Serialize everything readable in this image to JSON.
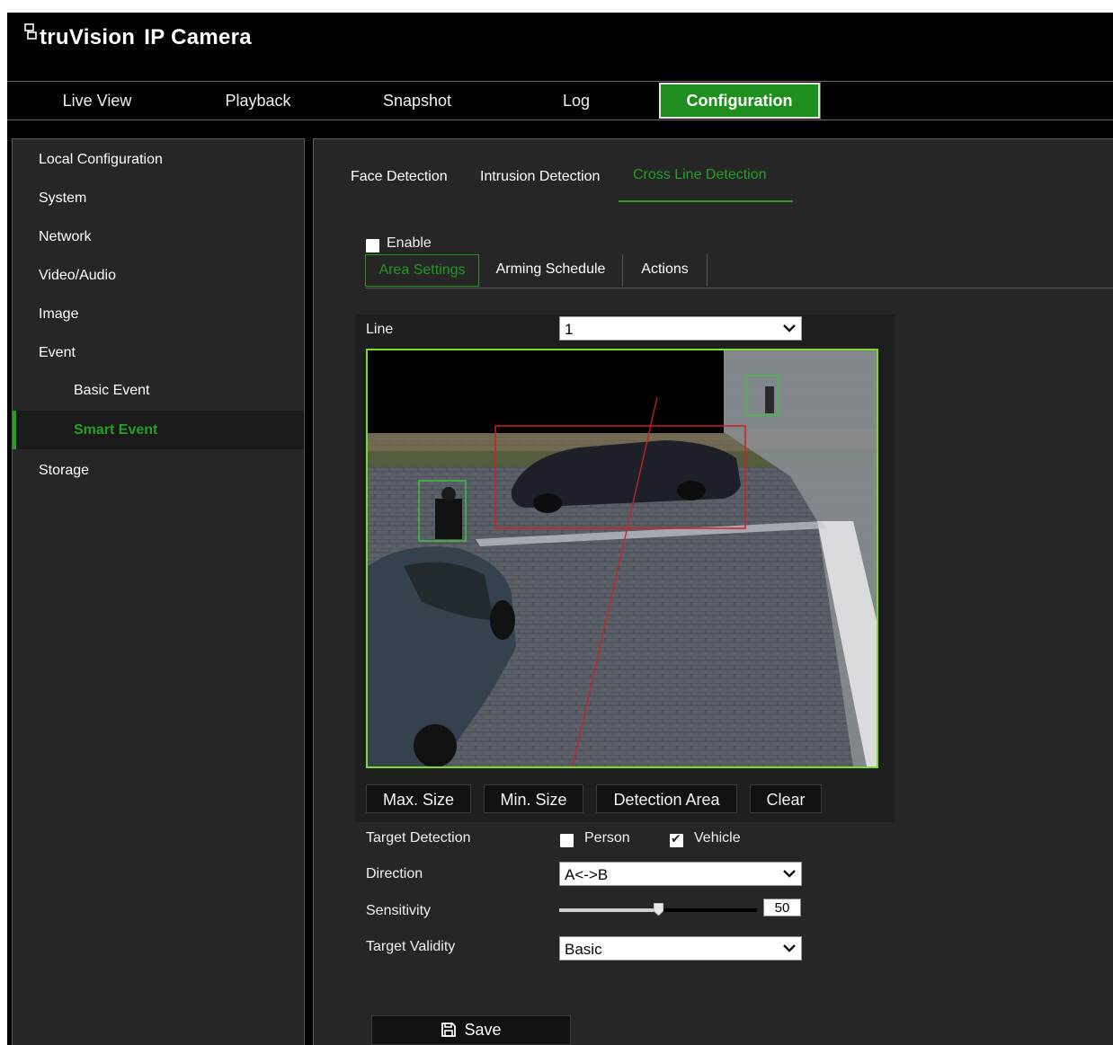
{
  "app": {
    "brand_prefix": "truVision",
    "brand_suffix": "IP Camera"
  },
  "nav": {
    "items": [
      "Live View",
      "Playback",
      "Snapshot",
      "Log",
      "Configuration"
    ],
    "active": "Configuration"
  },
  "sidebar": {
    "items": [
      "Local Configuration",
      "System",
      "Network",
      "Video/Audio",
      "Image",
      "Event"
    ],
    "event_sub": [
      "Basic Event",
      "Smart Event"
    ],
    "storage": "Storage",
    "active": "Smart Event"
  },
  "detection_tabs": {
    "items": [
      "Face Detection",
      "Intrusion Detection",
      "Cross Line Detection"
    ],
    "active": "Cross Line Detection"
  },
  "enable": {
    "label": "Enable",
    "checked": false
  },
  "settings_tabs": {
    "items": [
      "Area Settings",
      "Arming Schedule",
      "Actions"
    ],
    "active": "Area Settings"
  },
  "line": {
    "label": "Line",
    "value": "1"
  },
  "video_buttons": [
    "Max. Size",
    "Min. Size",
    "Detection Area",
    "Clear"
  ],
  "target_detection": {
    "label": "Target Detection",
    "person": {
      "label": "Person",
      "checked": false
    },
    "vehicle": {
      "label": "Vehicle",
      "checked": true
    }
  },
  "direction": {
    "label": "Direction",
    "value": "A<->B"
  },
  "sensitivity": {
    "label": "Sensitivity",
    "value": "50",
    "fraction": 0.5
  },
  "target_validity": {
    "label": "Target Validity",
    "value": "Basic"
  },
  "save": {
    "label": "Save"
  },
  "colors": {
    "accent_green": "#1e8f1e",
    "active_text_green": "#22a022",
    "video_border": "#7cdc2a",
    "detection_line": "#d21f1f"
  }
}
